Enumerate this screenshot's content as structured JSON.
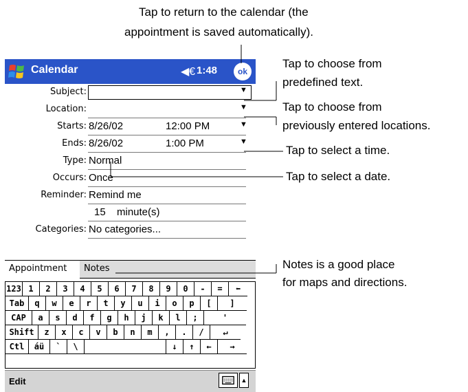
{
  "callouts": {
    "ok": "Tap to return to the calendar (the appointment is saved automatically).",
    "ok_line1": "Tap to return to the calendar (the",
    "ok_line2": "appointment is saved automatically).",
    "predefined_line1": "Tap to choose from",
    "predefined_line2": "predefined text.",
    "locations_line1": "Tap to choose from",
    "locations_line2": "previously entered locations.",
    "time": "Tap to select a time.",
    "date": "Tap to select a date.",
    "notes_line1": "Notes is a good place",
    "notes_line2": "for maps and directions."
  },
  "titlebar": {
    "app_title": "Calendar",
    "time": "1:48",
    "ok_label": "ok",
    "speaker": "◀€",
    "bg": "#2a54c8"
  },
  "form": {
    "subject": {
      "label": "Subject:",
      "value": ""
    },
    "location": {
      "label": "Location:",
      "value": ""
    },
    "starts": {
      "label": "Starts:",
      "date": "8/26/02",
      "time": "12:00 PM"
    },
    "ends": {
      "label": "Ends:",
      "date": "8/26/02",
      "time": "1:00 PM"
    },
    "type": {
      "label": "Type:",
      "value": "Normal"
    },
    "occurs": {
      "label": "Occurs:",
      "value": "Once"
    },
    "reminder": {
      "label": "Reminder:",
      "value": "Remind me"
    },
    "reminder_amount": {
      "number": "15",
      "unit": "minute(s)"
    },
    "categories": {
      "label": "Categories:",
      "value": "No categories..."
    },
    "dropdown_arrow": "▼"
  },
  "tabs": {
    "appointment": "Appointment",
    "notes": "Notes"
  },
  "keyboard": {
    "row1": [
      "123",
      "1",
      "2",
      "3",
      "4",
      "5",
      "6",
      "7",
      "8",
      "9",
      "0",
      "-",
      "=",
      "⬅"
    ],
    "row2": [
      "Tab",
      "q",
      "w",
      "e",
      "r",
      "t",
      "y",
      "u",
      "i",
      "o",
      "p",
      "[",
      "]"
    ],
    "row3": [
      "CAP",
      "a",
      "s",
      "d",
      "f",
      "g",
      "h",
      "j",
      "k",
      "l",
      ";",
      "'"
    ],
    "row4": [
      "Shift",
      "z",
      "x",
      "c",
      "v",
      "b",
      "n",
      "m",
      ",",
      ".",
      "/",
      "↵"
    ],
    "row5": [
      "Ctl",
      "áü",
      "`",
      "\\",
      "",
      "↓",
      "↑",
      "←",
      "→"
    ]
  },
  "cmdbar": {
    "edit": "Edit",
    "input_arrow": "▲"
  }
}
